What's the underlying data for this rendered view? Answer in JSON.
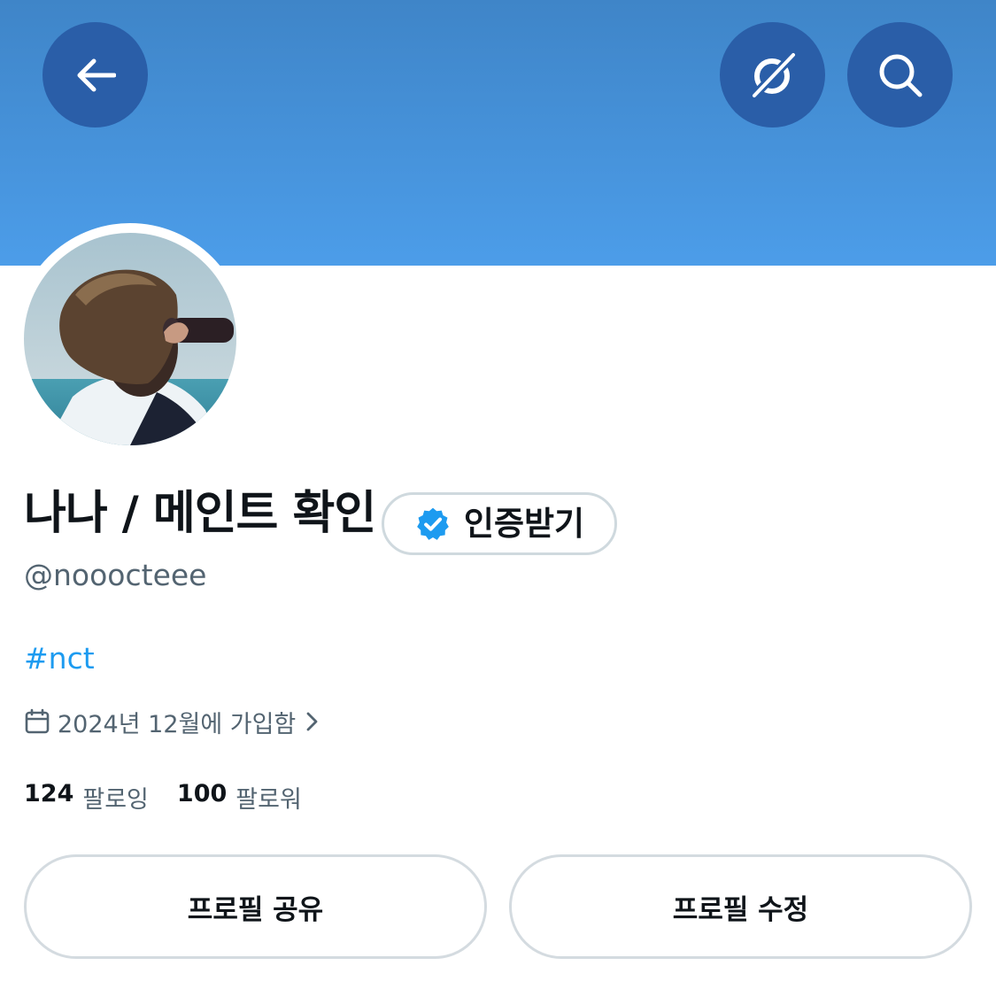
{
  "header": {
    "back_icon": "arrow-left-icon",
    "grok_icon": "grok-icon",
    "search_icon": "search-icon"
  },
  "profile": {
    "display_name": "나나 / 메인트 확인",
    "verify_button_label": "인증받기",
    "verified_icon": "verified-badge-icon",
    "handle": "@nooocteee",
    "bio_hashtag": "#nct",
    "joined_text": "2024년 12월에 가입함",
    "joined_icon": "calendar-icon",
    "following_count": "124",
    "following_label": "팔로잉",
    "followers_count": "100",
    "followers_label": "팔로워"
  },
  "actions": {
    "share_label": "프로필 공유",
    "edit_label": "프로필 수정"
  },
  "colors": {
    "banner": "#4a95dd",
    "header_button": "#2a5ea8",
    "link": "#1d9bf0",
    "secondary_text": "#536471"
  }
}
